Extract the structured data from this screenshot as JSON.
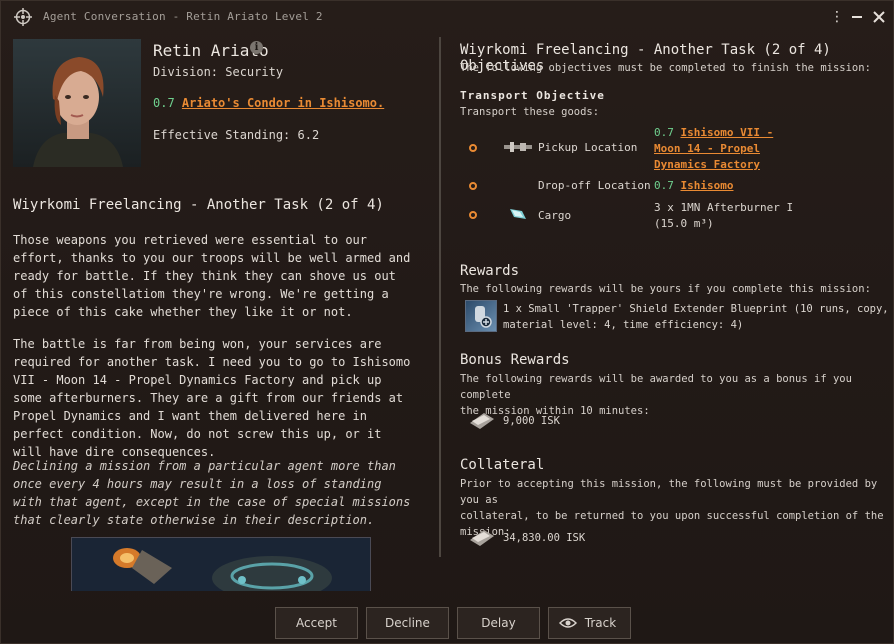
{
  "window": {
    "title": "Agent Conversation - Retin Ariato Level 2"
  },
  "agent": {
    "name": "Retin Ariato",
    "division": "Division: Security",
    "location_security": "0.7",
    "location_name": "Ariato's Condor in Ishisomo.",
    "standing": "Effective Standing: 6.2"
  },
  "mission": {
    "title": "Wiyrkomi Freelancing - Another Task (2 of 4)",
    "paragraphs": [
      "Those weapons you retrieved were essential to our effort, thanks to you our troops will be well armed and ready for battle. If they think they can shove us out of this constellatiom they're wrong. We're getting a piece of this cake whether they like it or not.",
      "The battle is far from being won, your services are required for another task. I need you to go to Ishisomo VII - Moon 14 - Propel Dynamics Factory and pick up some afterburners. They are a gift from our friends at Propel Dynamics and I want them delivered here in perfect condition. Now, do not screw this up, or it will have dire consequences."
    ],
    "warning": "Declining a mission from a particular agent more than once every 4 hours may result in a loss of standing with that agent, except in the case of special missions that clearly state otherwise in their description."
  },
  "objectives": {
    "title": "Wiyrkomi Freelancing - Another Task (2 of 4) Objectives",
    "subtitle": "The following objectives must be completed to finish the mission:",
    "transport_heading": "Transport Objective",
    "transport_sub": "Transport these goods:",
    "pickup_label": "Pickup Location",
    "pickup_security": "0.7",
    "pickup_line1": "Ishisomo VII -",
    "pickup_line2": "Moon 14 - Propel",
    "pickup_line3": "Dynamics Factory",
    "dropoff_label": "Drop-off Location",
    "dropoff_security": "0.7",
    "dropoff_name": "Ishisomo",
    "cargo_label": "Cargo",
    "cargo_line1": "3 x 1MN Afterburner I",
    "cargo_line2": "(15.0 m³)"
  },
  "rewards": {
    "heading": "Rewards",
    "sub": "The following rewards will be yours if you complete this mission:",
    "item_line1": "1 x Small 'Trapper' Shield Extender Blueprint (10 runs, copy,",
    "item_line2": "material level: 4, time efficiency: 4)"
  },
  "bonus": {
    "heading": "Bonus Rewards",
    "sub_line1": "The following rewards will be awarded to you as a bonus if you complete",
    "sub_line2": "the mission within 10 minutes:",
    "amount": "9,000 ISK"
  },
  "collateral": {
    "heading": "Collateral",
    "sub_line1": "Prior to accepting this mission, the following must be provided by you as",
    "sub_line2": "collateral, to be returned to you upon successful completion of the mission:",
    "amount": "34,830.00 ISK"
  },
  "buttons": {
    "accept": "Accept",
    "decline": "Decline",
    "delay": "Delay",
    "track": "Track"
  },
  "colors": {
    "accent": "#e98a33",
    "security_high": "#6fd08e",
    "background": "#221a17"
  }
}
